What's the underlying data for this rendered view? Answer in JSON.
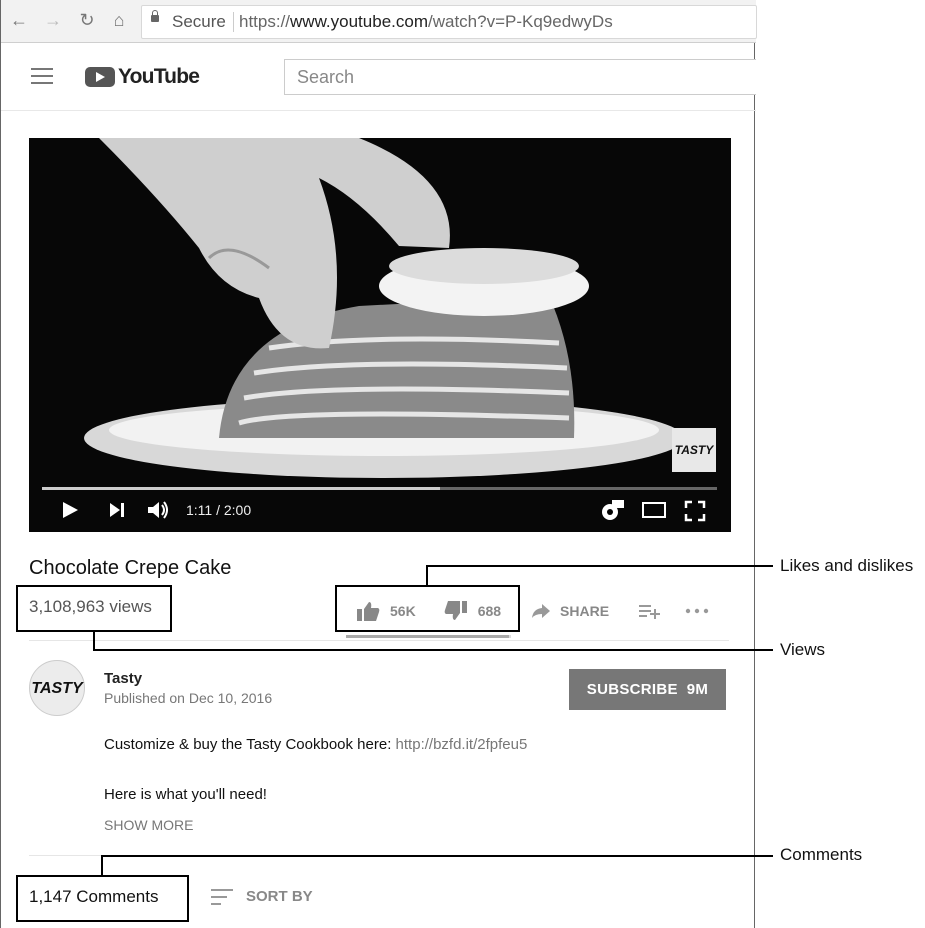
{
  "browser": {
    "secure_label": "Secure",
    "url_prefix": "https://",
    "url_host": "www.youtube.com",
    "url_path": "/watch?v=P-Kq9edwyDs"
  },
  "header": {
    "logo_text": "YouTube",
    "search_placeholder": "Search"
  },
  "player": {
    "timecode": "1:11 / 2:00",
    "progress": 0.59,
    "watermark": "TASTY"
  },
  "video": {
    "title": "Chocolate Crepe Cake",
    "views": "3,108,963 views",
    "likes": "56K",
    "dislikes": "688",
    "share_label": "SHARE",
    "like_ratio": 0.99
  },
  "channel": {
    "avatar_text": "TASTY",
    "name": "Tasty",
    "published": "Published on Dec 10, 2016",
    "subscribe_label": "SUBSCRIBE",
    "subscriber_count": "9M"
  },
  "description": {
    "line1_text": "Customize & buy the Tasty Cookbook here: ",
    "line1_link": "http://bzfd.it/2fpfeu5",
    "line2": "Here is what you'll need!",
    "show_more": "SHOW MORE"
  },
  "comments": {
    "count_label": "1,147 Comments",
    "sort_label": "SORT BY"
  },
  "annotations": {
    "likes_dislikes": "Likes and dislikes",
    "views": "Views",
    "comments": "Comments"
  }
}
